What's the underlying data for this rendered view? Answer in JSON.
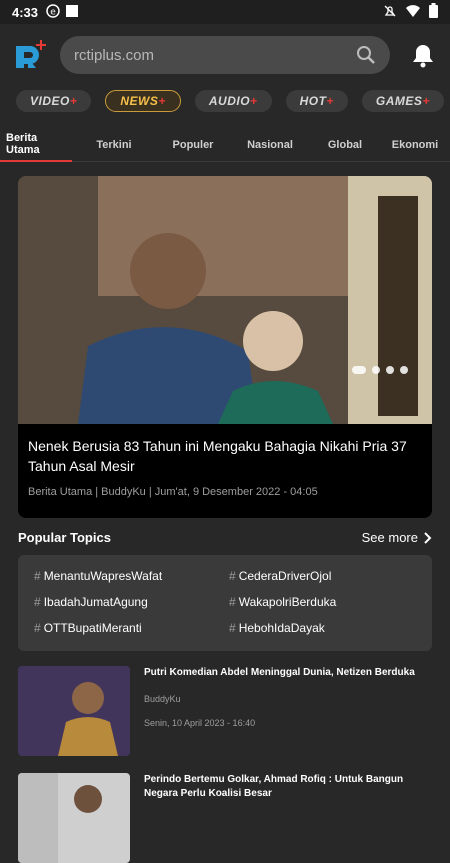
{
  "status": {
    "time": "4:33"
  },
  "header": {
    "search_text": "rctiplus.com"
  },
  "categories": [
    {
      "label": "VIDEO"
    },
    {
      "label": "NEWS",
      "active": true
    },
    {
      "label": "AUDIO"
    },
    {
      "label": "HOT"
    },
    {
      "label": "GAMES"
    }
  ],
  "tabs": [
    {
      "label": "Berita Utama",
      "active": true
    },
    {
      "label": "Terkini"
    },
    {
      "label": "Populer"
    },
    {
      "label": "Nasional"
    },
    {
      "label": "Global"
    },
    {
      "label": "Ekonomi"
    }
  ],
  "hero": {
    "title": "Nenek Berusia 83 Tahun ini Mengaku Bahagia Nikahi Pria 37 Tahun Asal Mesir",
    "meta": "Berita Utama | BuddyKu | Jum'at, 9 Desember 2022 - 04:05"
  },
  "popular": {
    "title": "Popular Topics",
    "see_more": "See more",
    "topics": [
      "MenantuWapresWafat",
      "CederaDriverOjol",
      "IbadahJumatAgung",
      "WakapolriBerduka",
      "OTTBupatiMeranti",
      "HebohIdaDayak"
    ]
  },
  "news": [
    {
      "title": "Putri Komedian Abdel Meninggal Dunia, Netizen Berduka",
      "source": "BuddyKu",
      "date": "Senin, 10 April 2023 - 16:40"
    },
    {
      "title": "Perindo Bertemu Golkar, Ahmad Rofiq : Untuk Bangun Negara Perlu Koalisi Besar"
    }
  ],
  "colors": {
    "accent": "#e53935",
    "news_gold": "#f6c04a",
    "bg": "#282828"
  }
}
